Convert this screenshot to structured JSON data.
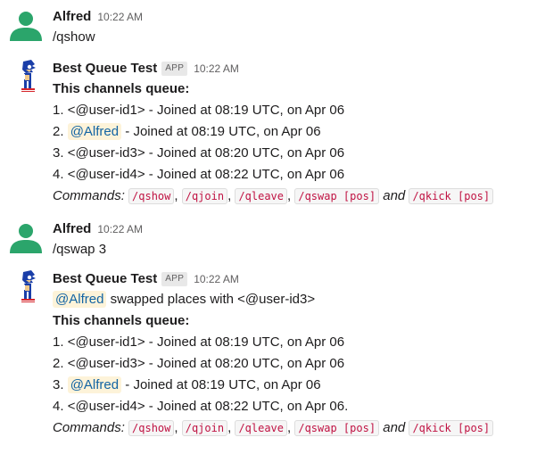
{
  "messages": [
    {
      "author": "Alfred",
      "time": "10:22 AM",
      "text": "/qshow"
    },
    {
      "author": "Best Queue Test",
      "badge": "APP",
      "time": "10:22 AM",
      "heading": "This channels queue:",
      "queue": [
        {
          "prefix": "1. ",
          "user": "<@user-id1>",
          "rest": " - Joined at 08:19 UTC, on Apr 06"
        },
        {
          "prefix": "2. ",
          "mention": "@Alfred",
          "rest": " - Joined at 08:19 UTC, on Apr 06"
        },
        {
          "prefix": "3. ",
          "user": "<@user-id3>",
          "rest": " - Joined at 08:20 UTC, on Apr 06"
        },
        {
          "prefix": "4. ",
          "user": "<@user-id4>",
          "rest": " - Joined at 08:22 UTC, on Apr 06"
        }
      ],
      "commands_label": "Commands:",
      "commands": [
        "/qshow",
        "/qjoin",
        "/qleave",
        "/qswap [pos]",
        "/qkick [pos]"
      ],
      "sep_comma": ",",
      "sep_and": "and"
    },
    {
      "author": "Alfred",
      "time": "10:22 AM",
      "text": "/qswap 3"
    },
    {
      "author": "Best Queue Test",
      "badge": "APP",
      "time": "10:22 AM",
      "intro_mention": "@Alfred",
      "intro_rest": " swapped places with <@user-id3>",
      "heading": "This channels queue:",
      "queue": [
        {
          "prefix": "1. ",
          "user": "<@user-id1>",
          "rest": " - Joined at 08:19 UTC, on Apr 06"
        },
        {
          "prefix": "2. ",
          "user": "<@user-id3>",
          "rest": " - Joined at 08:20 UTC, on Apr 06"
        },
        {
          "prefix": "3. ",
          "mention": "@Alfred",
          "rest": " - Joined at 08:19 UTC, on Apr 06"
        },
        {
          "prefix": "4. ",
          "user": "<@user-id4>",
          "rest": " - Joined at 08:22 UTC, on Apr 06."
        }
      ],
      "commands_label": "Commands:",
      "commands": [
        "/qshow",
        "/qjoin",
        "/qleave",
        "/qswap [pos]",
        "/qkick [pos]"
      ],
      "sep_comma": ",",
      "sep_and": "and"
    }
  ],
  "colors": {
    "mention_bg": "#fdf3d9",
    "mention_text": "#1264a3",
    "code_text": "#c01343",
    "avatar_green": "#2ba56b"
  },
  "icons": {
    "user_avatar": "person-silhouette-icon",
    "bot_avatar": "sonic-sprite-icon"
  }
}
